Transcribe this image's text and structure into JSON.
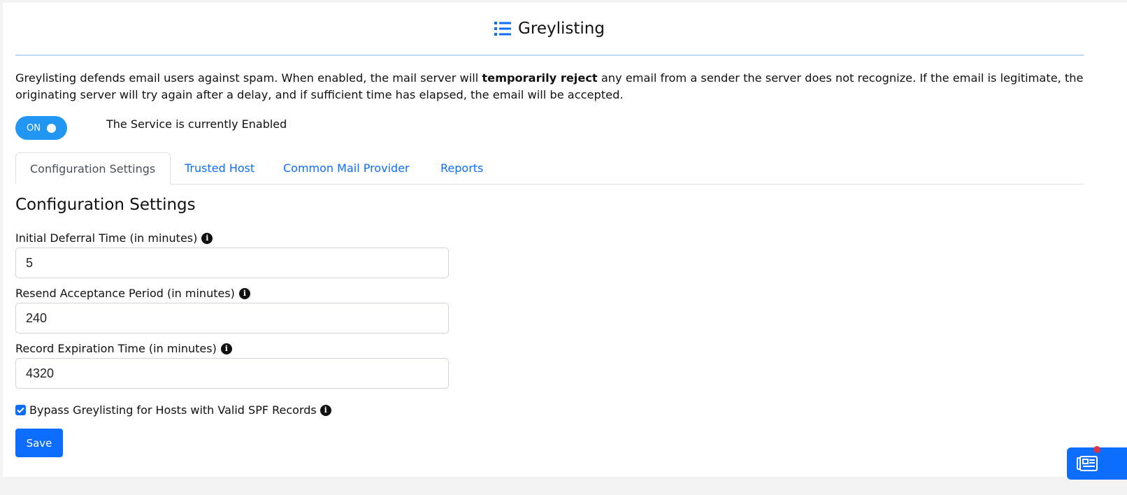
{
  "header": {
    "title": "Greylisting",
    "icon": "list-icon"
  },
  "description": {
    "before": "Greylisting defends email users against spam. When enabled, the mail server will ",
    "bold": "temporarily reject",
    "after": " any email from a sender the server does not recognize. If the email is legitimate, the originating server will try again after a delay, and if sufficient time has elapsed, the email will be accepted."
  },
  "service": {
    "toggle_label": "ON",
    "enabled": true,
    "status_text": "The Service is currently Enabled"
  },
  "tabs": [
    {
      "label": "Configuration Settings",
      "active": true
    },
    {
      "label": "Trusted Host",
      "active": false
    },
    {
      "label": "Common Mail Provider",
      "active": false
    },
    {
      "label": "Reports",
      "active": false
    }
  ],
  "config": {
    "section_title": "Configuration Settings",
    "fields": [
      {
        "label": "Initial Deferral Time (in minutes)",
        "value": "5",
        "info_icon": "info-icon"
      },
      {
        "label": "Resend Acceptance Period (in minutes)",
        "value": "240",
        "info_icon": "info-icon"
      },
      {
        "label": "Record Expiration Time (in minutes)",
        "value": "4320",
        "info_icon": "info-icon"
      }
    ],
    "bypass_spf": {
      "label": "Bypass Greylisting for Hosts with Valid SPF Records",
      "checked": true
    },
    "save_label": "Save"
  },
  "colors": {
    "primary": "#0d6efd",
    "toggle": "#2196f3",
    "header_rule": "#bcdaf3",
    "badge": "#dc3545"
  }
}
